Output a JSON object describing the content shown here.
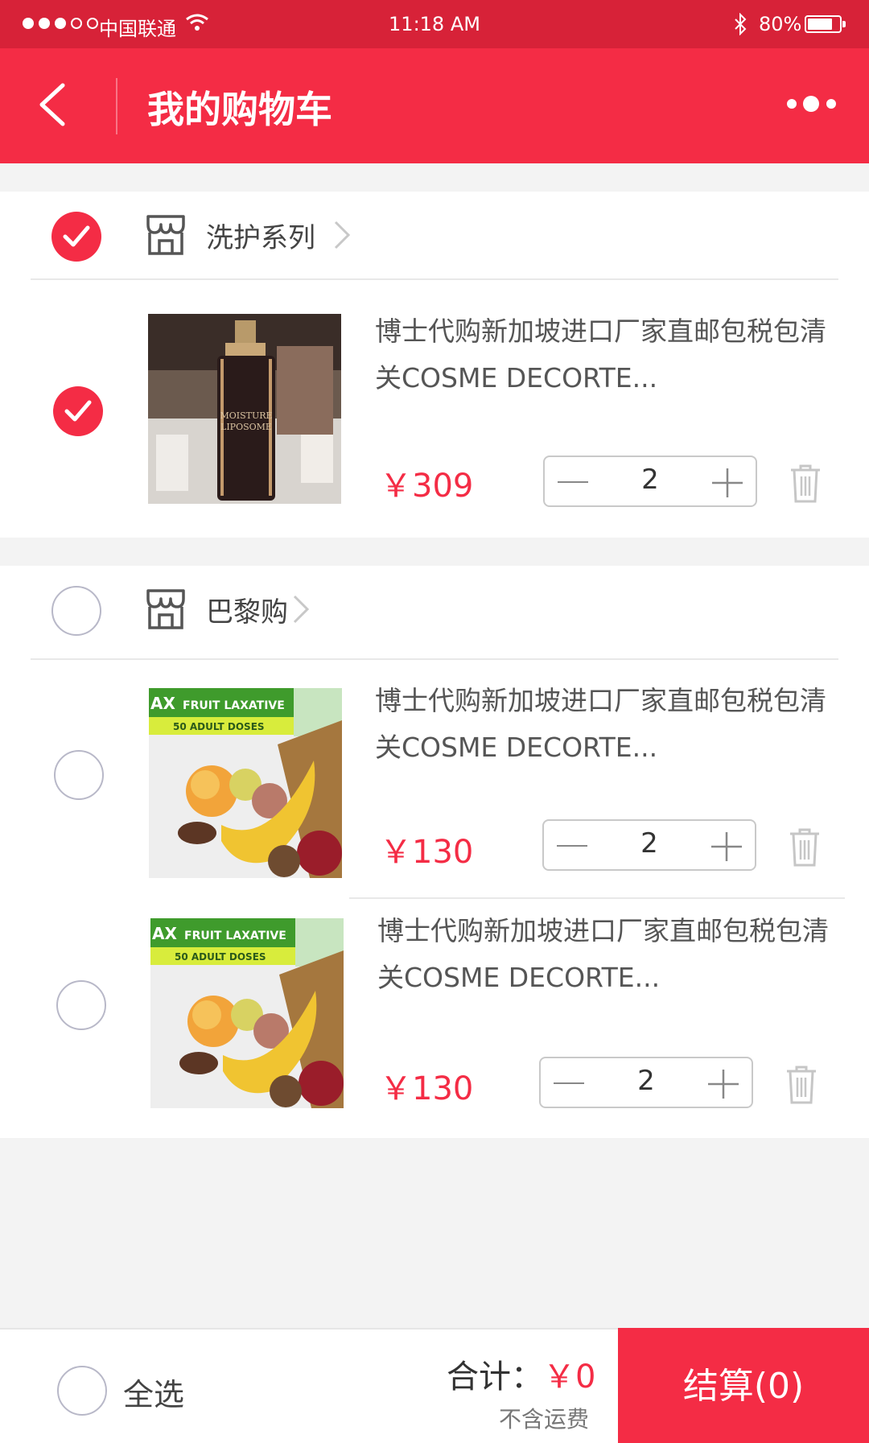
{
  "status_bar": {
    "carrier": "中国联通",
    "time": "11:18 AM",
    "battery": "80%",
    "battery_level": 0.8
  },
  "header": {
    "title": "我的购物车"
  },
  "groups": [
    {
      "shop_name": "洗护系列",
      "checked": true,
      "items": [
        {
          "name": "博士代购新加坡进口厂家直邮包税包清关COSME DECORTE...",
          "price": "￥309",
          "qty": "2",
          "checked": true,
          "image": "cosme-decorte-moisture-liposome"
        }
      ]
    },
    {
      "shop_name": "巴黎购",
      "checked": false,
      "items": [
        {
          "name": "博士代购新加坡进口厂家直邮包税包清关COSME DECORTE...",
          "price": "￥130",
          "qty": "2",
          "checked": false,
          "image": "fruit-laxative-box"
        },
        {
          "name": "博士代购新加坡进口厂家直邮包税包清关COSME DECORTE...",
          "price": "￥130",
          "qty": "2",
          "checked": false,
          "image": "fruit-laxative-box"
        }
      ]
    }
  ],
  "image_text": {
    "bottle_line1": "MOISTURE",
    "bottle_line2": "LIPOSOME",
    "laxative_title": "FRUIT LAXATIVE",
    "laxative_title_prefix": "AX",
    "laxative_doses": "50 ADULT DOSES"
  },
  "bottom_bar": {
    "select_all": "全选",
    "total_label": "合计：",
    "total_value": "￥0",
    "shipping_note": "不含运费",
    "checkout_label": "结算(0)"
  },
  "colors": {
    "status_bar": "#d72238",
    "brand": "#f42c45",
    "background": "#f3f3f3"
  },
  "icons": [
    "back-arrow-icon",
    "more-icon",
    "store-icon",
    "chevron-right-icon",
    "check-icon",
    "minus-icon",
    "plus-icon",
    "trash-icon",
    "wifi-icon",
    "bluetooth-icon",
    "battery-icon"
  ]
}
